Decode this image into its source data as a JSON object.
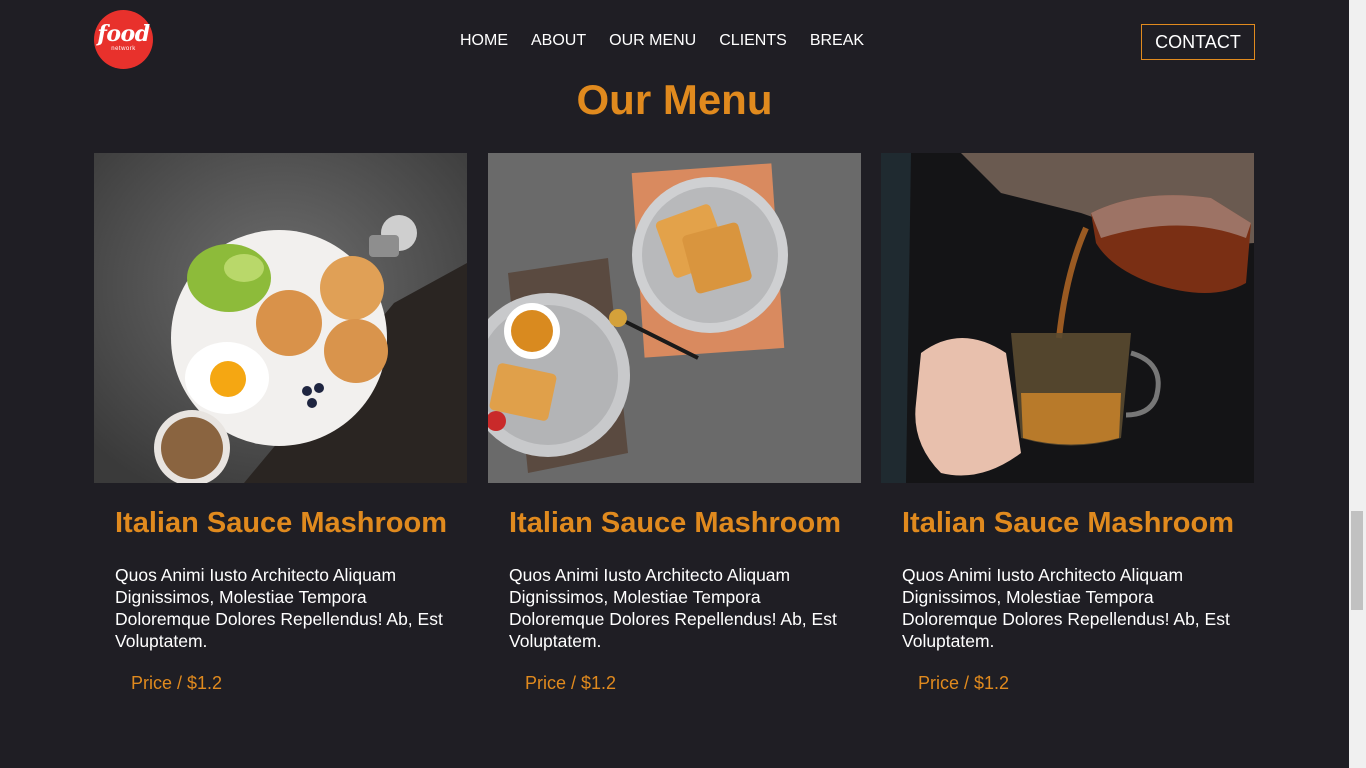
{
  "logo": {
    "word": "food",
    "sub": "network"
  },
  "nav": {
    "items": [
      {
        "label": "HOME"
      },
      {
        "label": "ABOUT"
      },
      {
        "label": "OUR MENU"
      },
      {
        "label": "CLIENTS"
      },
      {
        "label": "BREAK"
      }
    ]
  },
  "header": {
    "contact_label": "CONTACT"
  },
  "menu": {
    "title": "Our Menu",
    "cards": [
      {
        "image": "breakfast-plate-photo",
        "title": "Italian Sauce Mashroom",
        "description": "Quos Animi Iusto Architecto Aliquam Dignissimos, Molestiae Tempora Doloremque Dolores Repellendus! Ab, Est Voluptatem.",
        "price": "Price / $1.2"
      },
      {
        "image": "waffles-photo",
        "title": "Italian Sauce Mashroom",
        "description": "Quos Animi Iusto Architecto Aliquam Dignissimos, Molestiae Tempora Doloremque Dolores Repellendus! Ab, Est Voluptatem.",
        "price": "Price / $1.2"
      },
      {
        "image": "tea-pouring-photo",
        "title": "Italian Sauce Mashroom",
        "description": "Quos Animi Iusto Architecto Aliquam Dignissimos, Molestiae Tempora Doloremque Dolores Repellendus! Ab, Est Voluptatem.",
        "price": "Price / $1.2"
      }
    ]
  },
  "colors": {
    "background": "#1f1e24",
    "accent": "#e08a1e",
    "logo_red": "#e8312c"
  }
}
